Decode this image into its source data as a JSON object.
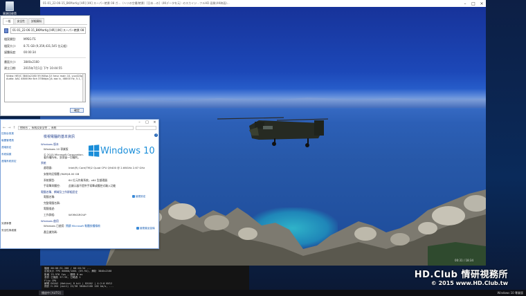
{
  "desktop": {
    "recycle_label": "資源回收筒"
  },
  "player": {
    "title": "01-01_22-06-15_BKMartig [HR] [4K] スーパー絶景 08 ガ…（ヘリの空撮/絶景）[日本…の]（4Kデータを元）のスカイジ…フルHD 画質(4K映画)…",
    "time_label": "00:31 / 18:34",
    "watermark_line1": "HD.Club 情研視務所",
    "watermark_line2": "© 2015  www.HD.Club.tw"
  },
  "info_panel": {
    "lines": [
      "檔案    00:00:31.260 / 00:18:34 ...",
      "目前大小  FPS 60000/1001 (59.94), 解析 3840x2160",
      "影格     23.976 fps , 顯像 8 ms",
      "音訊     已播放 37:35, 已略過 1",
      "Flip     CPU",
      "解碼     DXVA2 (Native) 8 bit | DXVA2 | 4:2:0 NV12",
      "視訊     H.264 (avc1) 22/30 3840x2160 128 kb/s, ..."
    ]
  },
  "props": {
    "tabs": [
      "一般",
      "安全性",
      "詳細資料"
    ],
    "filename": "01-01_22-06-15_BKMartig [HR] [4K] スーパー絶景 08 ガ…",
    "rows": [
      {
        "k": "檔案類型:",
        "v": "MPEG-TS"
      },
      {
        "k": "檔案大小:",
        "v": "8.71 GB (9,359,431,545 位元組)"
      },
      {
        "k": "媒體長度:",
        "v": "00:00:34"
      },
      {
        "k": "畫面大小:",
        "v": "3840x2160"
      },
      {
        "k": "建立日期:",
        "v": "2015年7月1日 下午 10:44:55"
      }
    ],
    "mediainfo": [
      "Video: HEVC 3840x2160 59.94fps [V: hevc main 10, yuv420p10le ...",
      "Audio: AAC 48000Hz 6ch 378kbps [A: aac lc, 48000 Hz, 5.1, 378 kb/s]"
    ],
    "ok_label": "確定"
  },
  "sys": {
    "path": [
      "控制台",
      "系統及安全性",
      "系統"
    ],
    "left_links": [
      "控制台首頁",
      "裝置管理員",
      "遠端設定",
      "系統保護",
      "進階系統設定"
    ],
    "left_bottom": [
      "另請參閱",
      "安全性與維護"
    ],
    "heading": "檢視電腦的基本資訊",
    "edition_section": "Windows 版本",
    "edition": "Windows 10 專業版",
    "copyright": "© 2015 Microsoft Corporation. 著作權所有，並保留一切權利。",
    "logo_text": "Windows 10",
    "system_section": "系統",
    "system_rows": [
      {
        "k": "處理器:",
        "v": "Intel(R) Core(TM)2 Quad CPU    Q9400 @ 2.66GHz   2.67 GHz"
      },
      {
        "k": "安裝的記憶體 (RAM):",
        "v": "8.00 GB"
      },
      {
        "k": "系統類型:",
        "v": "64 位元作業系統，x64 型處理器"
      },
      {
        "k": "手寫筆與觸控:",
        "v": "此顯示器不提供手寫筆或觸控式輸入功能"
      }
    ],
    "computer_section": "電腦名稱、網域及工作群組設定",
    "computer_rows": [
      {
        "k": "電腦名稱:",
        "v": ""
      },
      {
        "k": "完整電腦名稱:",
        "v": ""
      },
      {
        "k": "電腦描述:",
        "v": ""
      },
      {
        "k": "工作群組:",
        "v": "WORKGROUP"
      }
    ],
    "change_settings": "變更設定",
    "activation_section": "Windows 啟用",
    "activation": "Windows 已啟用",
    "license_link": "閱讀 Microsoft 軟體授權條款",
    "product_id": "產品識別碼:",
    "change_key": "變更產品金鑰"
  },
  "taskbar": {
    "item": "播放中 [AUTO]",
    "right": [
      "Windows 10 專業版"
    ]
  }
}
